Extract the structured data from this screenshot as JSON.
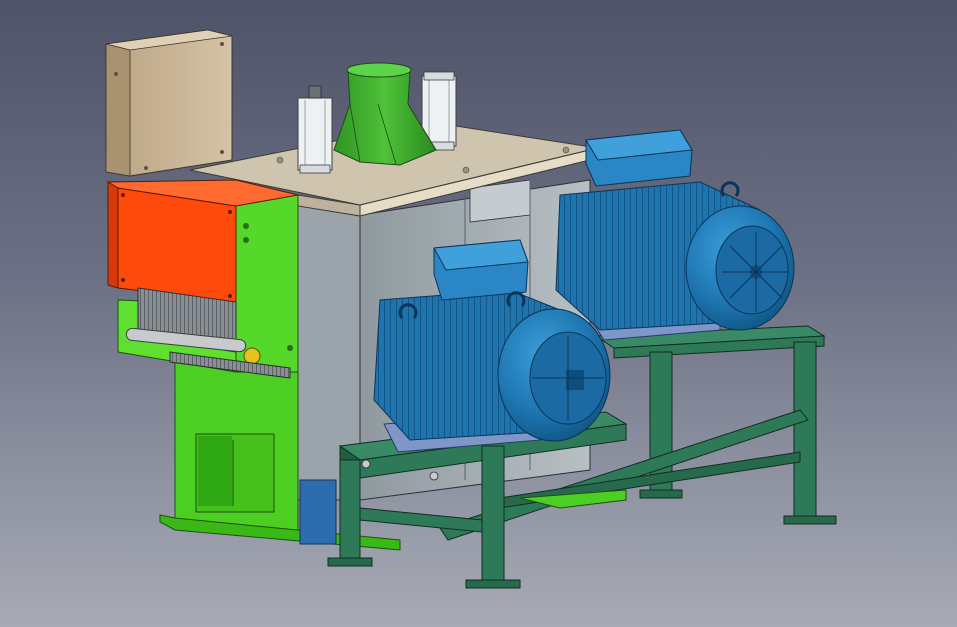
{
  "viewport": {
    "background_top": "#4f5367",
    "background_bottom": "#a8abb5"
  },
  "model": {
    "colors": {
      "cabinet": "#cdb89a",
      "hopper": "#3fae2f",
      "frame_green": "#4ccf22",
      "guard_orange": "#ff4a0c",
      "housing_grey": "#a7b0b5",
      "motor_blue": "#1f78b4",
      "stand_green": "#2e7a58",
      "baseplate": "#7f96c8"
    },
    "parts": [
      "control-cabinet",
      "feed-hopper",
      "pneumatic-cylinder-left",
      "pneumatic-cylinder-right",
      "top-plate",
      "main-housing",
      "orange-guard",
      "green-frame",
      "electric-motor-front",
      "electric-motor-rear",
      "motor-stand"
    ]
  }
}
